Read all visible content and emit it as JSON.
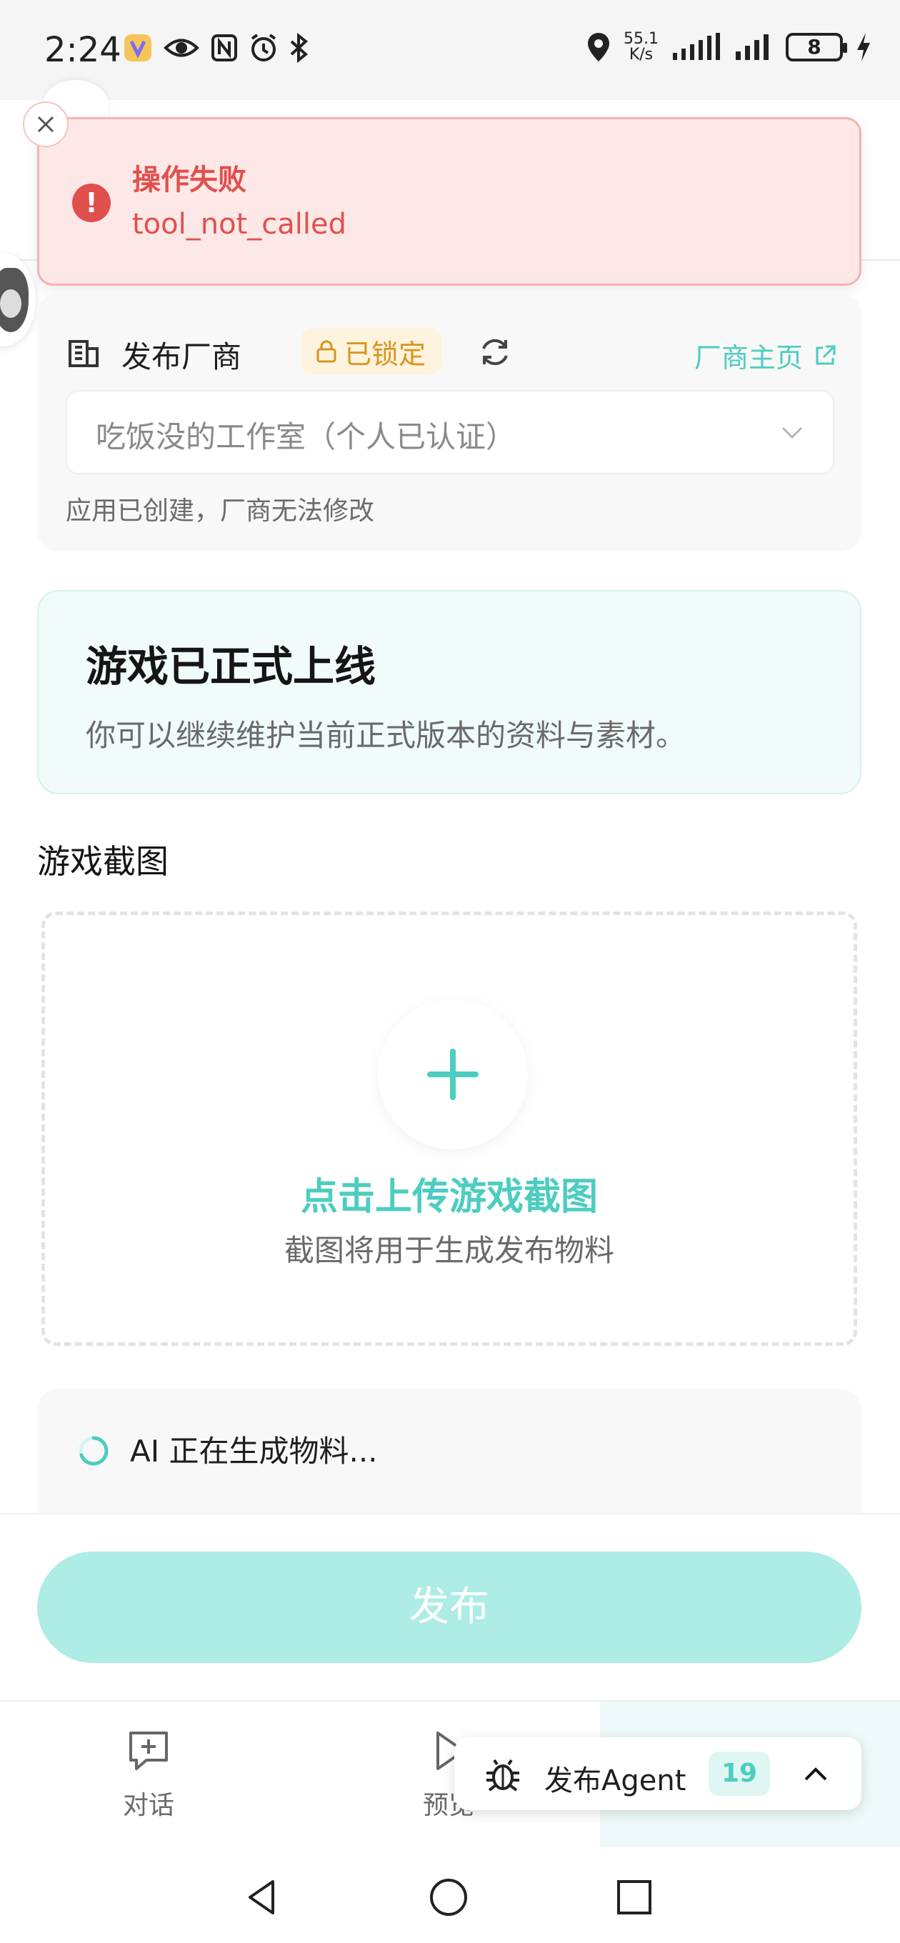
{
  "status_bar": {
    "time": "2:24",
    "net_speed_value": "55.1",
    "net_speed_unit": "K/s",
    "battery": "8"
  },
  "toast": {
    "title": "操作失败",
    "message": "tool_not_called",
    "icon": "error-icon",
    "color": "#e0504d"
  },
  "vendor": {
    "label": "发布厂商",
    "lock_label": "已锁定",
    "home_link": "厂商主页",
    "selected": "吃饭没的工作室（个人已认证）",
    "note": "应用已创建，厂商无法修改"
  },
  "online_banner": {
    "title": "游戏已正式上线",
    "description": "你可以继续维护当前正式版本的资料与素材。"
  },
  "screenshots": {
    "section_title": "游戏截图",
    "upload_title": "点击上传游戏截图",
    "upload_sub": "截图将用于生成发布物料"
  },
  "ai_status": {
    "text": "AI 正在生成物料..."
  },
  "publish": {
    "label": "发布"
  },
  "tabs": [
    {
      "label": "对话",
      "icon": "chat-add-icon"
    },
    {
      "label": "预览",
      "icon": "play-icon"
    }
  ],
  "agent_chip": {
    "label": "发布Agent",
    "count": "19"
  },
  "colors": {
    "accent": "#4ccdc0",
    "publish_disabled": "#aeece6",
    "lock": "#d9951a",
    "error": "#e0504d"
  }
}
